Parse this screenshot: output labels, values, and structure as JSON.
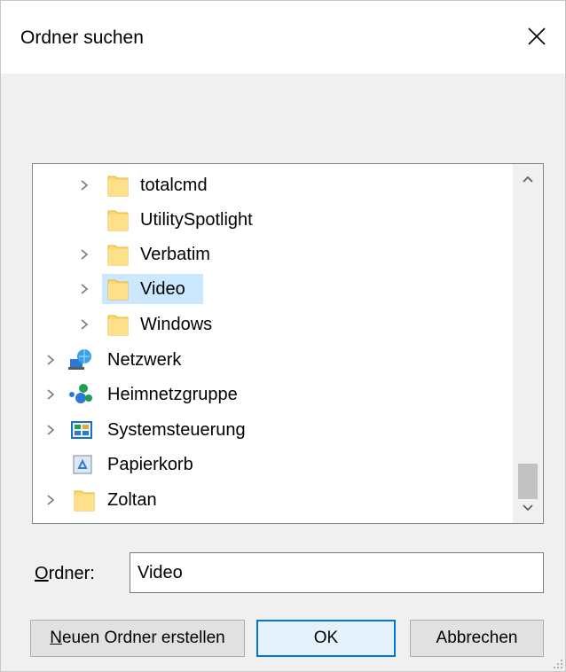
{
  "dialog": {
    "title": "Ordner suchen",
    "close_icon": "close-icon"
  },
  "tree": {
    "items": [
      {
        "label": "totalcmd",
        "icon": "folder-icon",
        "expandable": true,
        "selected": false
      },
      {
        "label": "UtilitySpotlight",
        "icon": "folder-icon",
        "expandable": false,
        "selected": false
      },
      {
        "label": "Verbatim",
        "icon": "folder-icon",
        "expandable": true,
        "selected": false
      },
      {
        "label": "Video",
        "icon": "folder-icon",
        "expandable": true,
        "selected": true
      },
      {
        "label": "Windows",
        "icon": "folder-icon",
        "expandable": true,
        "selected": false
      },
      {
        "label": "Netzwerk",
        "icon": "network-icon",
        "expandable": true,
        "selected": false
      },
      {
        "label": "Heimnetzgruppe",
        "icon": "homegroup-icon",
        "expandable": true,
        "selected": false
      },
      {
        "label": "Systemsteuerung",
        "icon": "control-panel-icon",
        "expandable": true,
        "selected": false
      },
      {
        "label": "Papierkorb",
        "icon": "recycle-bin-icon",
        "expandable": false,
        "selected": false
      },
      {
        "label": "Zoltan",
        "icon": "folder-icon",
        "expandable": true,
        "selected": false
      }
    ]
  },
  "folder_field": {
    "label_underlined": "O",
    "label_rest": "rdner:",
    "value": "Video"
  },
  "buttons": {
    "new_folder_underlined": "N",
    "new_folder_rest": "euen Ordner erstellen",
    "ok": "OK",
    "cancel": "Abbrechen"
  },
  "colors": {
    "selection": "#cce8ff",
    "folder": "#ffd86b",
    "accent": "#0078d7"
  }
}
